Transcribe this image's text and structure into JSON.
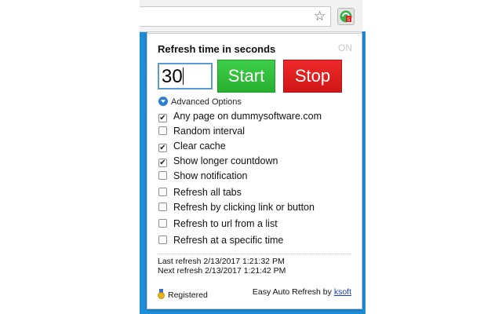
{
  "popup": {
    "title": "Refresh time in seconds",
    "status": "ON",
    "interval_value": "30",
    "start_label": "Start",
    "stop_label": "Stop",
    "advanced_label": "Advanced Options",
    "options": [
      {
        "label": "Any page on dummysoftware.com",
        "checked": true
      },
      {
        "label": "Random interval",
        "checked": false
      },
      {
        "label": "Clear cache",
        "checked": true
      },
      {
        "label": "Show longer countdown",
        "checked": true
      },
      {
        "label": "Show notification",
        "checked": false
      },
      {
        "label": "Refresh all tabs",
        "checked": false
      },
      {
        "label": "Refresh by clicking link or button",
        "checked": false
      },
      {
        "label": "Refresh to url from a list",
        "checked": false
      },
      {
        "label": "Refresh at a specific time",
        "checked": false
      }
    ],
    "last_refresh": "Last refresh 2/13/2017 1:21:32 PM",
    "next_refresh": "Next refresh 2/13/2017 1:21:42 PM",
    "registered_label": "Registered",
    "credit_text": "Easy Auto Refresh by ",
    "credit_link": "ksoft"
  },
  "icons": {
    "bookmark": "star-icon",
    "extension": "refresh-extension-icon",
    "advanced": "chevron-down-circle-icon",
    "registered": "medal-icon"
  },
  "colors": {
    "start": "#2fbe38",
    "stop": "#e01e1e",
    "frame_blue": "#1e8dd8",
    "input_border": "#5b9bd5",
    "link": "#1a3dc4"
  }
}
